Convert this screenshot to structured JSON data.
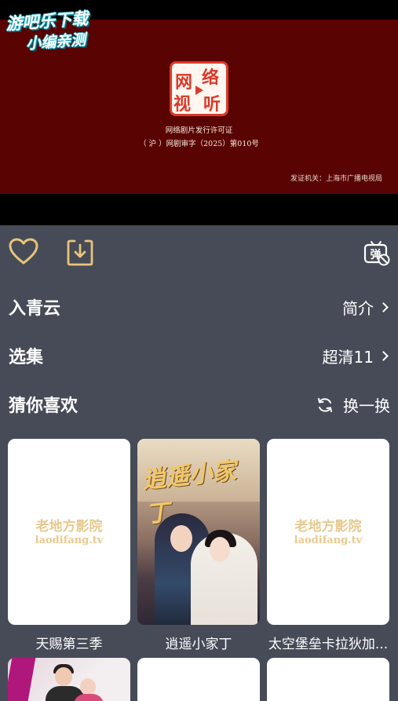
{
  "video": {
    "license_title": "网络剧片发行许可证",
    "license_number": "（ 沪 ）网剧审字（2025）第010号",
    "issuer": "发证机关：上海市广播电视局",
    "seal_chars": [
      "网",
      "络",
      "视",
      "听"
    ]
  },
  "watermark": {
    "line1": "游吧乐下载",
    "line2": "小编亲测"
  },
  "actions": {
    "favorite_icon": "heart-icon",
    "download_icon": "download-icon",
    "danmaku_icon": "danmaku-off-icon",
    "danmaku_glyph": "弹"
  },
  "detail": {
    "title": "入青云",
    "intro_label": "简介"
  },
  "episodes": {
    "label": "选集",
    "quality": "超清11"
  },
  "recommend": {
    "label": "猜你喜欢",
    "refresh_label": "换一换",
    "placeholder_name": "老地方影院",
    "placeholder_url": "laodifang.tv",
    "items": [
      {
        "title": "天赐第三季"
      },
      {
        "title": "逍遥小家丁",
        "poster_title": "逍遥小家丁"
      },
      {
        "title": "太空堡垒卡拉狄加..."
      }
    ]
  },
  "colors": {
    "background": "#464b57",
    "video_frame": "#5a0303",
    "seal_red": "#d93a2b",
    "icon_gold": "#e8c47a"
  }
}
